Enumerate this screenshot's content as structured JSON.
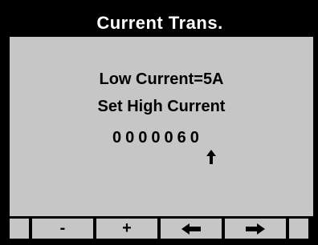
{
  "title": "Current Trans.",
  "content": {
    "line1": "Low Current=5A",
    "line2": "Set High Current",
    "value_digits": "0000060",
    "cursor_icon": "up-arrow-icon"
  },
  "softkeys": [
    {
      "label": "",
      "icon": null
    },
    {
      "label": "-",
      "icon": null
    },
    {
      "label": "+",
      "icon": null
    },
    {
      "label": "",
      "icon": "left-arrow-icon"
    },
    {
      "label": "",
      "icon": "right-arrow-icon"
    },
    {
      "label": "",
      "icon": null
    }
  ],
  "colors": {
    "background": "#000000",
    "panel": "#c6c6c6",
    "title_text": "#ffffff"
  }
}
